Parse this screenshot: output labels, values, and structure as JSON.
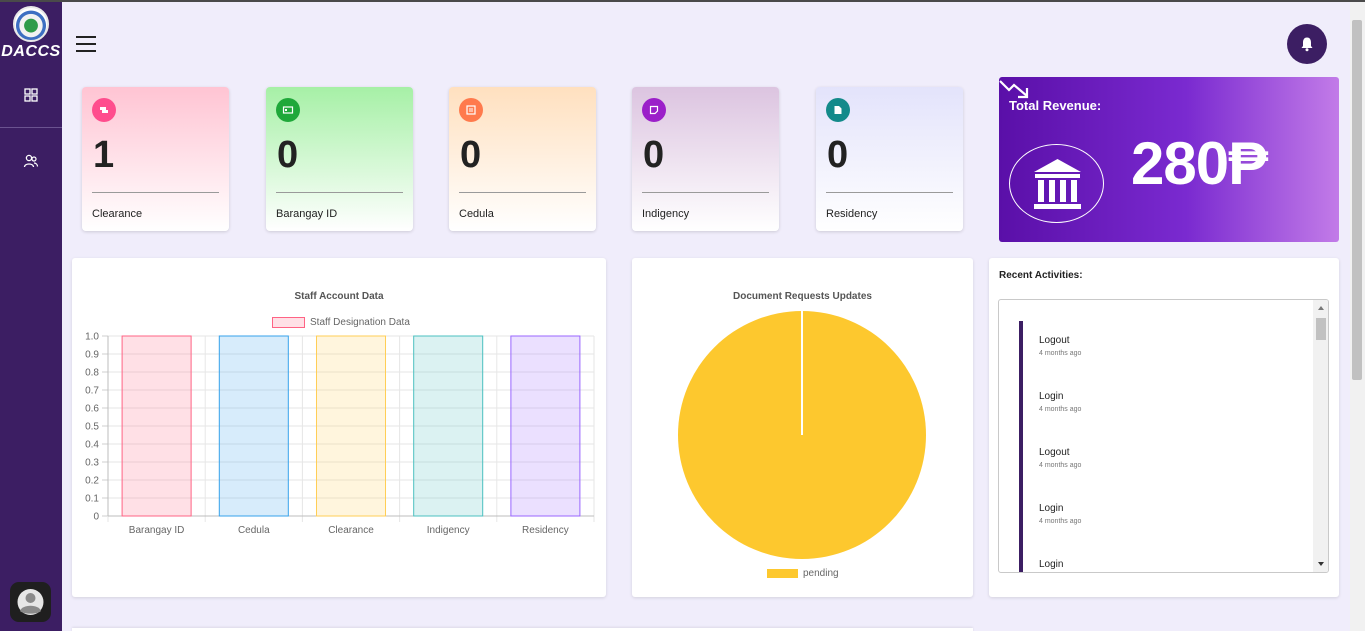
{
  "app": {
    "logo_text": "DACCS"
  },
  "sidebar": {
    "items": [
      {
        "icon": "grid-icon"
      },
      {
        "icon": "users-icon"
      }
    ]
  },
  "cards": [
    {
      "count": "1",
      "label": "Clearance",
      "color": "#ff4d8d",
      "icon": "clearance-icon"
    },
    {
      "count": "0",
      "label": "Barangay ID",
      "color": "#1fa83a",
      "icon": "id-card-icon"
    },
    {
      "count": "0",
      "label": "Cedula",
      "color": "#ff7a4d",
      "icon": "cedula-icon"
    },
    {
      "count": "0",
      "label": "Indigency",
      "color": "#9b1fc9",
      "icon": "indigency-icon"
    },
    {
      "count": "0",
      "label": "Residency",
      "color": "#138a8a",
      "icon": "residency-icon"
    }
  ],
  "revenue": {
    "title": "Total Revenue:",
    "amount": "280₱"
  },
  "staff_chart": {
    "title": "Staff Account Data",
    "legend": "Staff Designation Data"
  },
  "doc_chart": {
    "title": "Document Requests Updates",
    "legend": "pending"
  },
  "chart_data": [
    {
      "type": "bar",
      "title": "Staff Account Data",
      "categories": [
        "Barangay ID",
        "Cedula",
        "Clearance",
        "Indigency",
        "Residency"
      ],
      "series": [
        {
          "name": "Staff Designation Data",
          "values": [
            1,
            1,
            1,
            1,
            1
          ]
        }
      ],
      "colors": [
        "#ff6384",
        "#36a2eb",
        "#ffce56",
        "#4bc0c0",
        "#9966ff"
      ],
      "ylim": [
        0,
        1.0
      ],
      "yticks": [
        "0",
        "0.1",
        "0.2",
        "0.3",
        "0.4",
        "0.5",
        "0.6",
        "0.7",
        "0.8",
        "0.9",
        "1.0"
      ],
      "grid": true,
      "legend_position": "top"
    },
    {
      "type": "pie",
      "title": "Document Requests Updates",
      "categories": [
        "pending"
      ],
      "values": [
        1
      ],
      "colors": [
        "#fdc82e"
      ],
      "legend_position": "bottom"
    }
  ],
  "activities": {
    "title": "Recent Activities:",
    "items": [
      {
        "action": "Logout",
        "time": "4 months ago"
      },
      {
        "action": "Login",
        "time": "4 months ago"
      },
      {
        "action": "Logout",
        "time": "4 months ago"
      },
      {
        "action": "Login",
        "time": "4 months ago"
      },
      {
        "action": "Login",
        "time": ""
      }
    ]
  }
}
